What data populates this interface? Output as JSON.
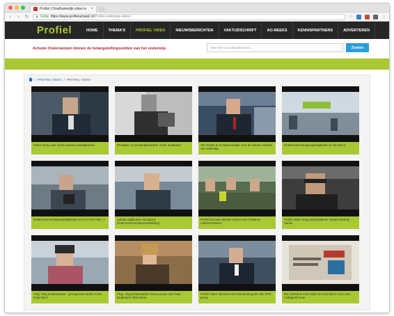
{
  "browser": {
    "tab_title": "Profiel | Onafhankelijk video tv",
    "tab_close": "×",
    "secure_label": "Veilig",
    "url_host": "https://www.profielactueel.nl",
    "url_path": "/Profiel-onderwijs-video/"
  },
  "site": {
    "logo": "Profiel",
    "menu": [
      {
        "label": "HOME"
      },
      {
        "label": "THEMA'S"
      },
      {
        "label": "PROFIEL VIDEO",
        "active": true
      },
      {
        "label": "NIEUWSBERICHTEN"
      },
      {
        "label": "VAKTIJDSCHRIFT"
      },
      {
        "label": "AO-REEKS"
      },
      {
        "label": "KENNISPARTNERS"
      },
      {
        "label": "ADVERTEREN"
      }
    ],
    "tagline": "Actuele Onderwerpen binnen de belangstellingsvelden van het onderwijs",
    "search_placeholder": "Vaar hier uw zoekopdracht in...",
    "search_button": "Zoeken",
    "breadcrumb": [
      "PROFIEL VIDEO",
      "PROFIEL VIDEO"
    ]
  },
  "videos": [
    {
      "caption": "Pieter Stoey over 21ste-eeuwse vaardigheden"
    },
    {
      "caption": "Prestatie- en presentatiebeleid: onder studenten"
    },
    {
      "caption": "Ton Hearts & Jet Bussemaker over de nieuwe minister van onderwijs"
    },
    {
      "caption": "Ondernemerschapsvaardigheden in het mbo II"
    },
    {
      "caption": "Ondernemerschapsvaardigheden (e) en in het mbo - I"
    },
    {
      "caption": "Juliette Stijkhuizen Nooijieser Ondernemerschapsontwikkeling"
    },
    {
      "caption": "Profiel bezoekt Nieroks school voor creatieve rudiekenmakers"
    },
    {
      "caption": "Profiel Video Vlog ambassadeurs student Ibrahim Sarian"
    },
    {
      "caption": "Vlog: Vlog ambassadeur - ja-weg komt straks in het buitenland"
    },
    {
      "caption": "Vlog: Vlog ambassadeur Ilena Lassue over haar studietijd in Barcelona"
    },
    {
      "caption": "Profiel Video Interview met Ton Bruining de mbo RPC groep"
    },
    {
      "caption": "Een interview met Carlijn en Fred (ROC A12) over Collegetal Issue"
    }
  ]
}
